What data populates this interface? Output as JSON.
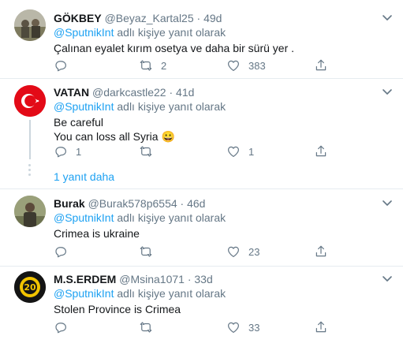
{
  "tweets": [
    {
      "name": "GÖKBEY",
      "handle": "@Beyaz_Kartal25",
      "separator": "·",
      "time": "49d",
      "reply_link": "@SputnikInt",
      "reply_suffix": "adlı kişiye yanıt olarak",
      "lines": [
        "Çalınan eyalet kırım osetya ve daha bir sürü yer ."
      ],
      "replies": "",
      "retweets": "2",
      "likes": "383"
    },
    {
      "name": "VATAN",
      "handle": "@darkcastle22",
      "separator": "·",
      "time": "41d",
      "reply_link": "@SputnikInt",
      "reply_suffix": "adlı kişiye yanıt olarak",
      "lines": [
        "Be careful",
        "You can loss all Syria 😀"
      ],
      "replies": "1",
      "retweets": "",
      "likes": "1"
    },
    {
      "name": "Burak",
      "handle": "@Burak578p6554",
      "separator": "·",
      "time": "46d",
      "reply_link": "@SputnikInt",
      "reply_suffix": "adlı kişiye yanıt olarak",
      "lines": [
        "Crimea is ukraine"
      ],
      "replies": "",
      "retweets": "",
      "likes": "23"
    },
    {
      "name": "M.S.ERDEM",
      "handle": "@Msina1071",
      "separator": "·",
      "time": "33d",
      "reply_link": "@SputnikInt",
      "reply_suffix": "adlı kişiye yanıt olarak",
      "lines": [
        "Stolen Province is Crimea"
      ],
      "replies": "",
      "retweets": "",
      "likes": "33"
    }
  ],
  "show_more_replies": "1 yanıt daha",
  "colors": {
    "accent": "#1da1f2",
    "muted": "#657786",
    "divider": "#e6ecf0",
    "turkish_flag": "#e30a17"
  }
}
